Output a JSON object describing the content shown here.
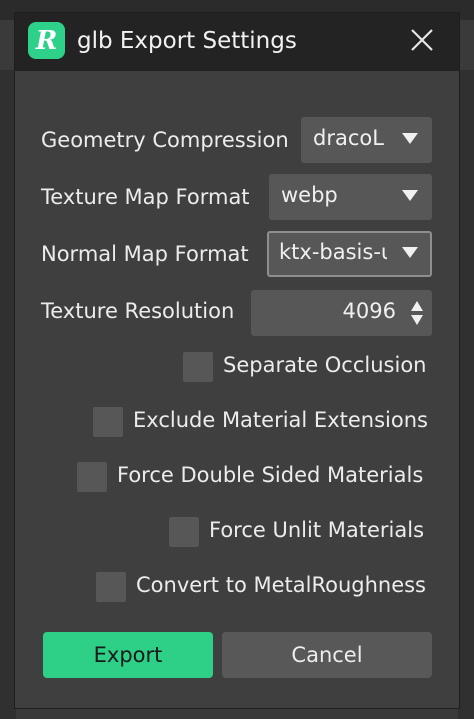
{
  "window": {
    "title": "glb Export Settings",
    "logo_glyph": "R",
    "accent_color": "#2ed18a"
  },
  "fields": {
    "geometry_compression": {
      "label": "Geometry Compression",
      "value": "dracoL"
    },
    "texture_map_format": {
      "label": "Texture Map Format",
      "value": "webp"
    },
    "normal_map_format": {
      "label": "Normal Map Format",
      "value": "ktx-basis-u"
    },
    "texture_resolution": {
      "label": "Texture Resolution",
      "value": "4096"
    }
  },
  "options": [
    {
      "label": "Separate Occlusion",
      "checked": false
    },
    {
      "label": "Exclude Material Extensions",
      "checked": false
    },
    {
      "label": "Force Double Sided Materials",
      "checked": false
    },
    {
      "label": "Force Unlit Materials",
      "checked": false
    },
    {
      "label": "Convert to MetalRoughness",
      "checked": false
    }
  ],
  "buttons": {
    "export": "Export",
    "cancel": "Cancel"
  },
  "icons": {
    "close": "close-icon",
    "dropdown": "chevron-down-icon",
    "spinner": "spinner-arrows-icon"
  }
}
